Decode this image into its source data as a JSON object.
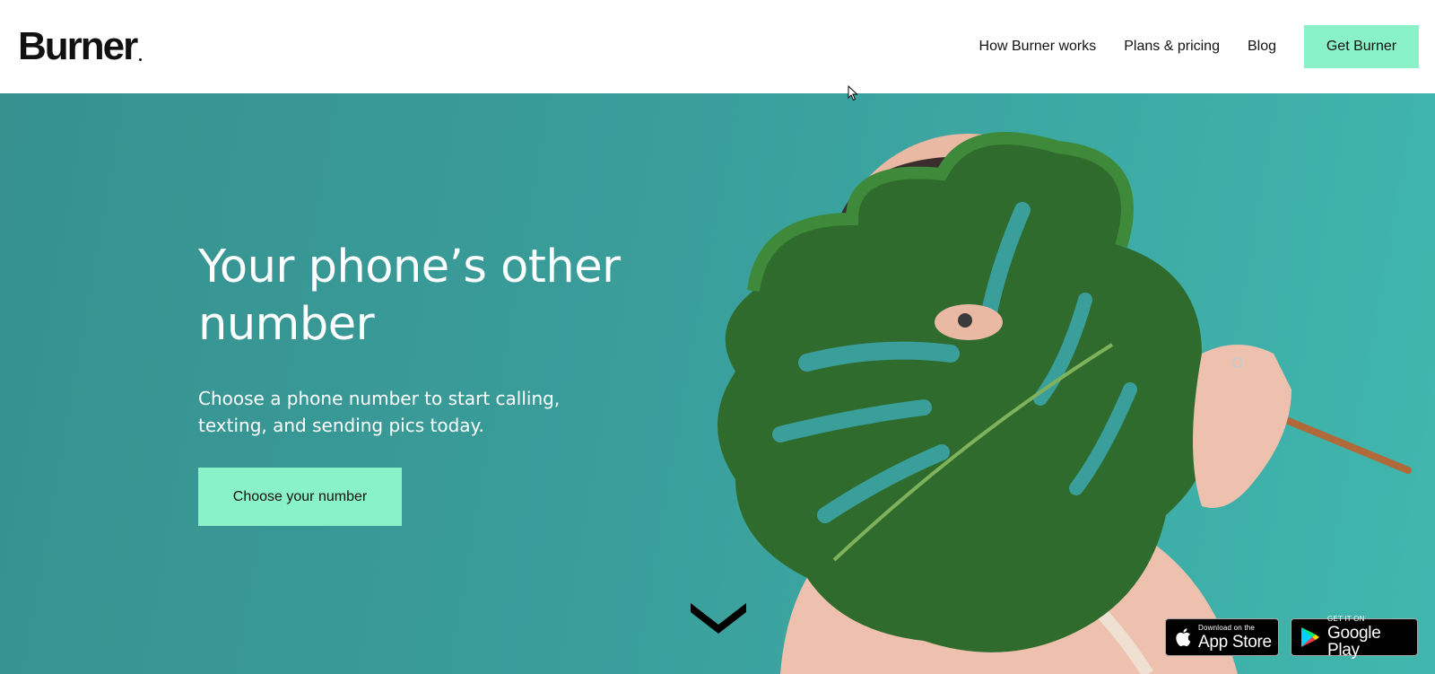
{
  "header": {
    "logo_text": "Burner",
    "nav": [
      {
        "label": "How Burner works"
      },
      {
        "label": "Plans & pricing"
      },
      {
        "label": "Blog"
      }
    ],
    "cta_label": "Get Burner"
  },
  "hero": {
    "title": "Your phone’s other number",
    "subtitle": "Choose a phone number to start calling, texting, and sending pics today.",
    "cta_label": "Choose your number",
    "scroll_icon": "chevron-down-icon",
    "image": "person-holding-monstera-leaf"
  },
  "badges": {
    "app_store": {
      "small": "Download on the",
      "big": "App Store",
      "icon": "apple-icon"
    },
    "google_play": {
      "small": "GET IT ON",
      "big": "Google Play",
      "icon": "google-play-icon"
    }
  },
  "colors": {
    "accent": "#8af2c8",
    "hero_bg": "#3a9e9b",
    "text_dark": "#111111",
    "text_light": "#ffffff"
  }
}
